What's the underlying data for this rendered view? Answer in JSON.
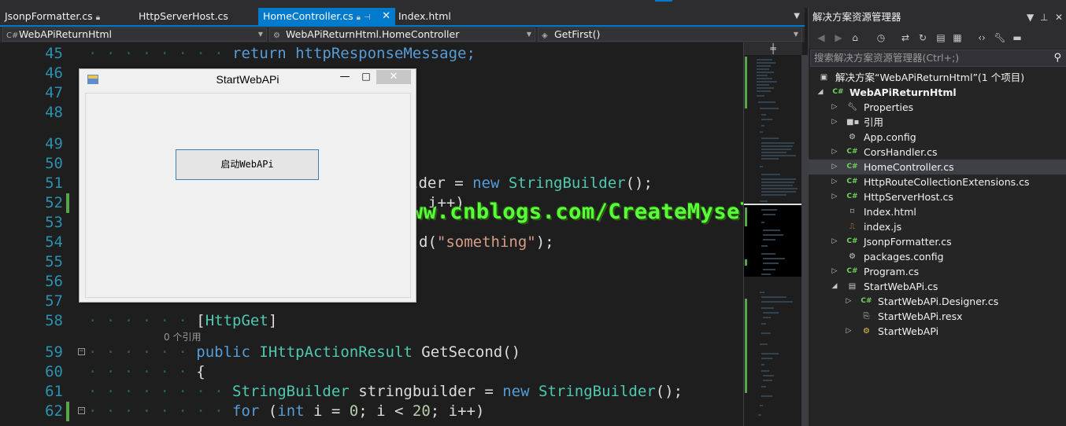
{
  "tabs": [
    {
      "label": "JsonpFormatter.cs",
      "pinned": true,
      "active": false
    },
    {
      "label": "HttpServerHost.cs",
      "pinned": false,
      "active": false
    },
    {
      "label": "HomeController.cs",
      "pinned": true,
      "active": true
    },
    {
      "label": "Index.html",
      "pinned": false,
      "active": false
    }
  ],
  "navbar": {
    "project": "WebAPiReturnHtml",
    "class": "WebAPiReturnHtml.HomeController",
    "member": "GetFirst()"
  },
  "editor": {
    "line_numbers": [
      "45",
      "46",
      "47",
      "48",
      "49",
      "50",
      "51",
      "52",
      "53",
      "54",
      "55",
      "56",
      "57",
      "58",
      "59",
      "60",
      "61",
      "62"
    ],
    "line_45": "return httpResponseMessage;",
    "line_51_tail": "lder = ",
    "line_51_new": "new",
    "line_51_type": "StringBuilder",
    "line_51_end": "();",
    "line_52_tail": "i++)",
    "line_54_tail": "d(",
    "line_54_str": "\"something\"",
    "line_54_end": ");",
    "line_58_attr_open": "[",
    "line_58_attr": "HttpGet",
    "line_58_attr_close": "]",
    "codelens": "0 个引用",
    "line_59_kw": "public",
    "line_59_type": "IHttpActionResult",
    "line_59_rest": " GetSecond()",
    "line_60": "{",
    "line_61_type": "StringBuilder",
    "line_61_mid": " stringbuilder = ",
    "line_61_new": "new",
    "line_61_type2": "StringBuilder",
    "line_61_end": "();",
    "line_62_for": "for",
    "line_62_open": " (",
    "line_62_int": "int",
    "line_62_mid": " i = ",
    "line_62_zero": "0",
    "line_62_cmp": "; i < ",
    "line_62_twenty": "20",
    "line_62_end": "; i++)"
  },
  "watermark": "http://www.cnblogs.com/CreateMyself/",
  "dialog": {
    "title": "StartWebAPi",
    "minimize": "—",
    "maximize": "□",
    "close": "✕",
    "button_label": "启动WebAPi"
  },
  "solution_explorer": {
    "title": "解决方案资源管理器",
    "search_placeholder": "搜索解决方案资源管理器(Ctrl+;)",
    "solution": "解决方案“WebAPiReturnHtml”(1 个项目)",
    "project": "WebAPiReturnHtml",
    "items": [
      {
        "label": "Properties",
        "icon": "wrench-icon",
        "expandable": true
      },
      {
        "label": "引用",
        "icon": "references-icon",
        "expandable": true
      },
      {
        "label": "App.config",
        "icon": "config-icon",
        "expandable": false
      },
      {
        "label": "CorsHandler.cs",
        "icon": "csharp-file-icon",
        "expandable": true
      },
      {
        "label": "HomeController.cs",
        "icon": "csharp-file-icon",
        "expandable": true,
        "selected": true
      },
      {
        "label": "HttpRouteCollectionExtensions.cs",
        "icon": "csharp-file-icon",
        "expandable": true
      },
      {
        "label": "HttpServerHost.cs",
        "icon": "csharp-file-icon",
        "expandable": true
      },
      {
        "label": "Index.html",
        "icon": "html-file-icon",
        "expandable": false
      },
      {
        "label": "index.js",
        "icon": "js-file-icon",
        "expandable": false
      },
      {
        "label": "JsonpFormatter.cs",
        "icon": "csharp-file-icon",
        "expandable": true
      },
      {
        "label": "packages.config",
        "icon": "config-icon",
        "expandable": false
      },
      {
        "label": "Program.cs",
        "icon": "csharp-file-icon",
        "expandable": true
      },
      {
        "label": "StartWebAPi.cs",
        "icon": "form-icon",
        "expandable": true,
        "expanded": true
      },
      {
        "label": "StartWebAPi.Designer.cs",
        "icon": "csharp-file-icon",
        "expandable": true,
        "child": true
      },
      {
        "label": "StartWebAPi.resx",
        "icon": "resource-file-icon",
        "expandable": false,
        "child": true
      },
      {
        "label": "StartWebAPi",
        "icon": "class-icon",
        "expandable": true,
        "child": true
      }
    ]
  },
  "colors": {
    "accent": "#007acc",
    "background": "#1e1e1e",
    "keyword": "#569cd6",
    "type": "#4ec9b0",
    "string": "#d69d85",
    "line_number": "#2b91af",
    "change_bar": "#57a64a",
    "watermark": "#58ff3a"
  }
}
